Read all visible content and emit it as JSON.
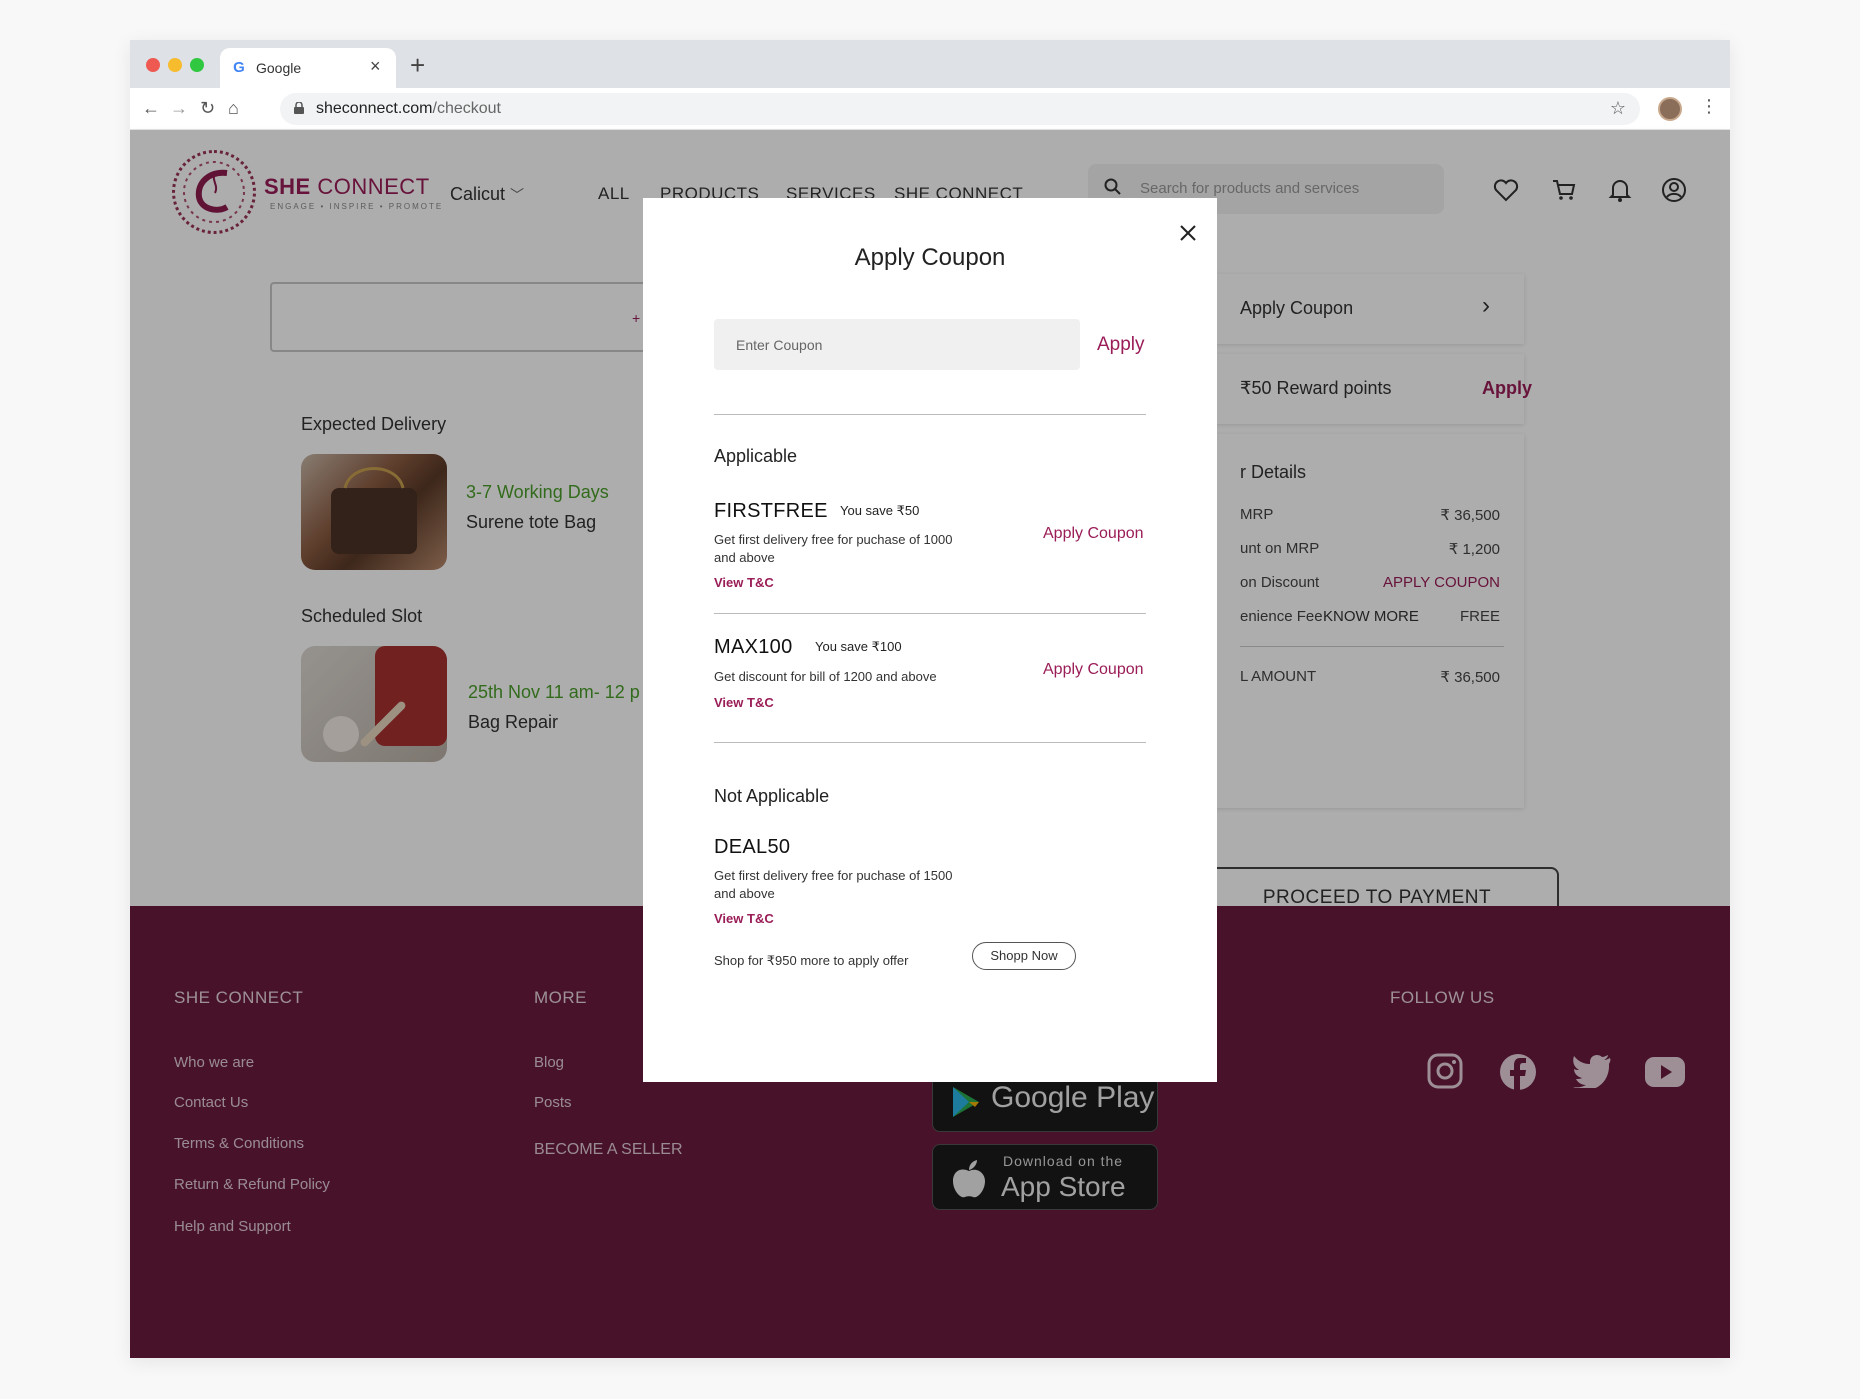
{
  "browser": {
    "tab_title": "Google",
    "url_host": "sheconnect.com",
    "url_path": "/checkout"
  },
  "header": {
    "logo_bold": "SHE",
    "logo_light": " CONNECT",
    "logo_tagline": "ENGAGE • INSPIRE • PROMOTE",
    "city": "Calicut",
    "menu": [
      "ALL",
      "PRODUCTS",
      "SERVICES",
      "SHE CONNECT"
    ],
    "search_placeholder": "Search for products and services"
  },
  "order": {
    "address_plus": "+",
    "expected_delivery_label": "Expected Delivery",
    "delivery_time": "3-7 Working Days",
    "delivery_item": "Surene tote Bag",
    "scheduled_slot_label": "Scheduled Slot",
    "slot_time": "25th Nov  11 am- 12 p",
    "slot_item": "Bag Repair"
  },
  "sidebar": {
    "apply_coupon": "Apply Coupon",
    "reward_points": "₹50 Reward points",
    "reward_apply": "Apply",
    "details_title": "r Details",
    "rows": [
      {
        "label": "MRP",
        "value": "₹  36,500"
      },
      {
        "label": "unt on MRP",
        "value": "₹  1,200"
      },
      {
        "label": "on Discount",
        "value": "APPLY COUPON"
      },
      {
        "label": "enience Fee",
        "extra": "KNOW MORE",
        "value": "FREE"
      }
    ],
    "total_label": "L AMOUNT",
    "total_value": "₹ 36,500",
    "proceed": "PROCEED TO PAYMENT"
  },
  "footer": {
    "col1_title": "SHE CONNECT",
    "col1_links": [
      "Who we are",
      "Contact Us",
      "Terms & Conditions",
      "Return & Refund Policy",
      "Help and Support"
    ],
    "col2_title": "MORE",
    "col2_links": [
      "Blog",
      "Posts"
    ],
    "become_seller": "BECOME A SELLER",
    "google_play": "Google Play",
    "app_store_small": "Download on the",
    "app_store_big": "App Store",
    "follow_us": "FOLLOW US"
  },
  "modal": {
    "title": "Apply Coupon",
    "input_placeholder": "Enter Coupon",
    "apply": "Apply",
    "applicable_title": "Applicable",
    "coupons": [
      {
        "code": "FIRSTFREE",
        "save": "You save  ₹50",
        "desc": "Get first delivery free for puchase of 1000 and above",
        "tnc": "View T&C",
        "action": "Apply Coupon"
      },
      {
        "code": "MAX100",
        "save": "You save  ₹100",
        "desc": "Get discount for bill of 1200 and above",
        "tnc": "View T&C",
        "action": "Apply Coupon"
      }
    ],
    "not_applicable_title": "Not Applicable",
    "na_coupon": {
      "code": "DEAL50",
      "desc": "Get first delivery free for puchase of 1500 and above",
      "tnc": "View T&C"
    },
    "shop_note": "Shop for  ₹950 more to apply offer",
    "shop_now": "Shopp Now"
  },
  "colors": {
    "brand": "#9a1d57",
    "footer_bg": "#6a1b40",
    "green": "#4a9e2a"
  }
}
